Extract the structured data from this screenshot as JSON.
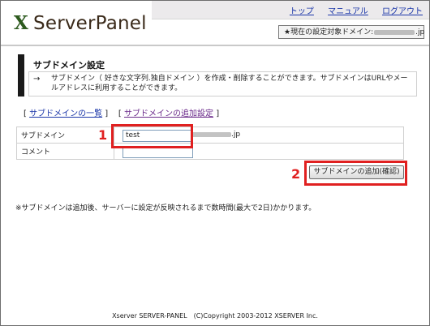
{
  "header": {
    "logo_mark": "X",
    "logo_name": "ServerPanel",
    "nav": [
      "トップ",
      "マニュアル",
      "ログアウト"
    ],
    "domain_label": "★現在の設定対象ドメイン:",
    "domain_suffix": ".jp"
  },
  "section": {
    "title": "サブドメイン設定",
    "arrow": "→",
    "description": "サブドメイン（ 好きな文字列.独自ドメイン ）を作成・削除することができます。サブドメインはURLやメールアドレスに利用することができます。"
  },
  "tabs": {
    "open_bracket": "[",
    "close_bracket": "]",
    "list": "サブドメインの一覧",
    "add": "サブドメインの追加設定"
  },
  "form": {
    "subdomain_label": "サブドメイン",
    "subdomain_value": "test",
    "domain_suffix": ".jp",
    "comment_label": "コメント",
    "comment_value": "",
    "submit": "サブドメインの追加(確認)"
  },
  "annotations": {
    "step1": "1",
    "step2": "2",
    "color": "#e02020"
  },
  "note": "※サブドメインは追加後、サーバーに設定が反映されるまで数時間(最大で2日)かかります。",
  "footer": "Xserver SERVER-PANEL　(C)Copyright 2003-2012 XSERVER Inc."
}
